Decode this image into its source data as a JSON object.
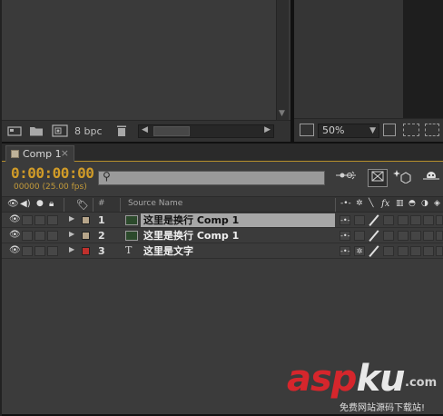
{
  "project_panel": {
    "bit_depth": "8 bpc",
    "icons": [
      "interpret-footage-icon",
      "new-folder-icon",
      "new-composition-icon",
      "trash-icon"
    ]
  },
  "comp_viewer": {
    "zoom": "50%"
  },
  "timeline": {
    "tab_label": "Comp 1",
    "timecode": "0:00:00:00",
    "frame_info": "00000 (25.00 fps)",
    "search_placeholder": "",
    "columns": {
      "number": "#",
      "source_name": "Source Name",
      "fx": "fx"
    },
    "layers": [
      {
        "number": "1",
        "name": "这里是换行 Comp 1",
        "type": "precomp",
        "label_color": "#b6a58a",
        "selected": true
      },
      {
        "number": "2",
        "name": "这里是换行 Comp 1",
        "type": "precomp",
        "label_color": "#b6a58a",
        "selected": false
      },
      {
        "number": "3",
        "name": "这里是文字",
        "type": "text",
        "label_color": "#c0302c",
        "selected": false
      }
    ]
  },
  "watermark": {
    "brand_a": "asp",
    "brand_b": "ku",
    "tld": ".com",
    "subtitle": "免费网站源码下载站!"
  },
  "colors": {
    "accent_orange": "#d09b28",
    "panel_bg": "#3b3b3b",
    "watermark_red": "#d6262c"
  }
}
